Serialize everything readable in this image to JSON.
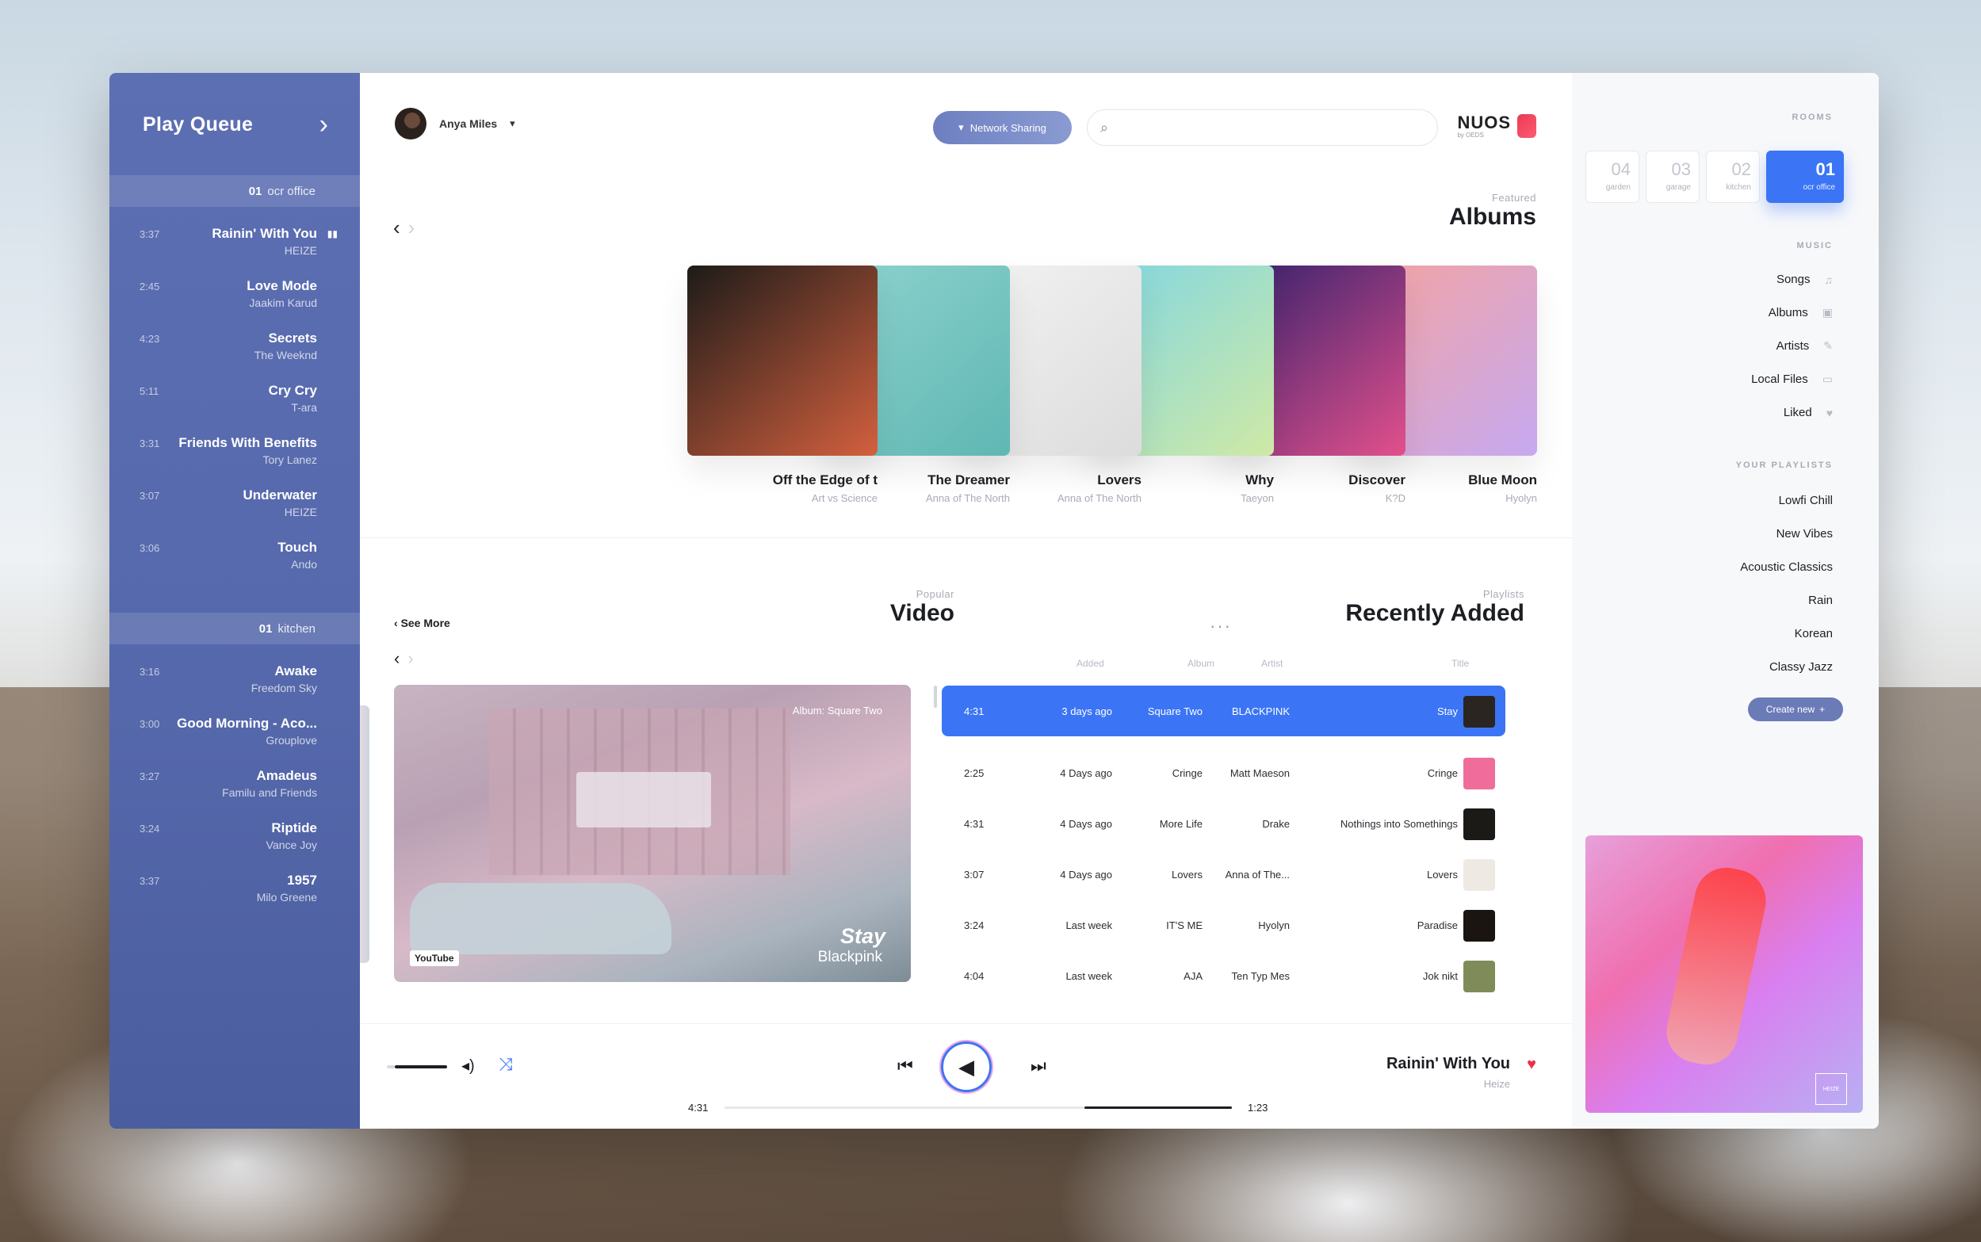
{
  "queue": {
    "title": "Play Queue",
    "groups": [
      {
        "room_num": "01",
        "room_name": "ocr office",
        "items": [
          {
            "title": "Rainin' With You",
            "artist": "HEIZE",
            "duration": "3:37",
            "playing": true
          },
          {
            "title": "Love Mode",
            "artist": "Jaakim Karud",
            "duration": "2:45"
          },
          {
            "title": "Secrets",
            "artist": "The Weeknd",
            "duration": "4:23"
          },
          {
            "title": "Cry Cry",
            "artist": "T-ara",
            "duration": "5:11"
          },
          {
            "title": "Friends With Benefits",
            "artist": "Tory Lanez",
            "duration": "3:31"
          },
          {
            "title": "Underwater",
            "artist": "HEIZE",
            "duration": "3:07"
          },
          {
            "title": "Touch",
            "artist": "Ando",
            "duration": "3:06"
          }
        ]
      },
      {
        "room_num": "01",
        "room_name": "kitchen",
        "items": [
          {
            "title": "Awake",
            "artist": "Freedom Sky",
            "duration": "3:16"
          },
          {
            "title": "Good Morning - Aco...",
            "artist": "Grouplove",
            "duration": "3:00"
          },
          {
            "title": "Amadeus",
            "artist": "Familu and Friends",
            "duration": "3:27"
          },
          {
            "title": "Riptide",
            "artist": "Vance Joy",
            "duration": "3:24"
          },
          {
            "title": "1957",
            "artist": "Milo Greene",
            "duration": "3:37"
          }
        ]
      }
    ]
  },
  "header": {
    "user_name": "Anya Miles",
    "network_button": "Network Sharing",
    "search_placeholder": "",
    "logo_text": "NUOS",
    "logo_sub": "by OEDS"
  },
  "featured": {
    "subtitle": "Featured",
    "title": "Albums",
    "albums": [
      {
        "name": "Blue Moon",
        "artist": "Hyolyn",
        "colors": [
          "#f5a3a0",
          "#c6a9f0"
        ]
      },
      {
        "name": "Discover",
        "artist": "K?D",
        "colors": [
          "#2e1f6b",
          "#e2508c"
        ]
      },
      {
        "name": "Why",
        "artist": "Taeyon",
        "colors": [
          "#7fd6e3",
          "#cfe9a6"
        ]
      },
      {
        "name": "Lovers",
        "artist": "Anna of The North",
        "colors": [
          "#f3f3f3",
          "#dcdcdc"
        ]
      },
      {
        "name": "The Dreamer",
        "artist": "Anna of The North",
        "colors": [
          "#8fd3cf",
          "#5fb7b3"
        ]
      },
      {
        "name": "Off the Edge of t",
        "artist": "Art vs Science",
        "colors": [
          "#1d1b19",
          "#d3603e"
        ]
      }
    ]
  },
  "recently": {
    "subtitle": "Playlists",
    "title": "Recently Added",
    "columns": [
      "Title",
      "Artist",
      "Album",
      "Added"
    ],
    "rows": [
      {
        "title": "Stay",
        "artist": "BLACKPINK",
        "album": "Square Two",
        "added": "3 days ago",
        "time": "4:31",
        "active": true,
        "thumb": "#2b2522"
      },
      {
        "title": "Cringe",
        "artist": "Matt Maeson",
        "album": "Cringe",
        "added": "4 Days ago",
        "time": "2:25",
        "thumb": "#f06c9b"
      },
      {
        "title": "Nothings into Somethings",
        "artist": "Drake",
        "album": "More Life",
        "added": "4 Days ago",
        "time": "4:31",
        "thumb": "#1c1a17"
      },
      {
        "title": "Lovers",
        "artist": "Anna of The...",
        "album": "Lovers",
        "added": "4 Days ago",
        "time": "3:07",
        "thumb": "#efe9e4"
      },
      {
        "title": "Paradise",
        "artist": "Hyolyn",
        "album": "IT'S ME",
        "added": "Last week",
        "time": "3:24",
        "thumb": "#1a1510"
      },
      {
        "title": "Jok nikt",
        "artist": "Ten Typ Mes",
        "album": "AJA",
        "added": "Last week",
        "time": "4:04",
        "thumb": "#7f8c5a"
      }
    ]
  },
  "video": {
    "subtitle": "Popular",
    "title": "Video",
    "see_more": "See More",
    "song": "Stay",
    "artist": "Blackpink",
    "album": "Album: Square Two",
    "source": "YouTube"
  },
  "player": {
    "song": "Rainin' With You",
    "artist": "Heize",
    "current_time": "1:23",
    "total_time": "4:31",
    "progress": 0.29,
    "volume": 0.85
  },
  "rooms": {
    "label": "ROOMS",
    "tabs": [
      {
        "num": "01",
        "name": "ocr office",
        "active": true
      },
      {
        "num": "02",
        "name": "kitchen"
      },
      {
        "num": "03",
        "name": "garage"
      },
      {
        "num": "04",
        "name": "garden"
      }
    ],
    "music_label": "MUSIC",
    "music": [
      {
        "label": "Songs",
        "icon": "note-icon"
      },
      {
        "label": "Albums",
        "icon": "album-icon"
      },
      {
        "label": "Artists",
        "icon": "mic-icon"
      },
      {
        "label": "Local Files",
        "icon": "folder-icon"
      },
      {
        "label": "Liked",
        "icon": "heart-icon"
      }
    ],
    "playlists_label": "YOUR PLAYLISTS",
    "playlists": [
      "Lowfi Chill",
      "New Vibes",
      "Acoustic Classics",
      "Rain",
      "Korean",
      "Classy Jazz"
    ],
    "create_label": "Create new"
  },
  "colors": {
    "accent": "#3b75f5",
    "queue_bg": "#5568ab",
    "heart": "#e8324c"
  }
}
